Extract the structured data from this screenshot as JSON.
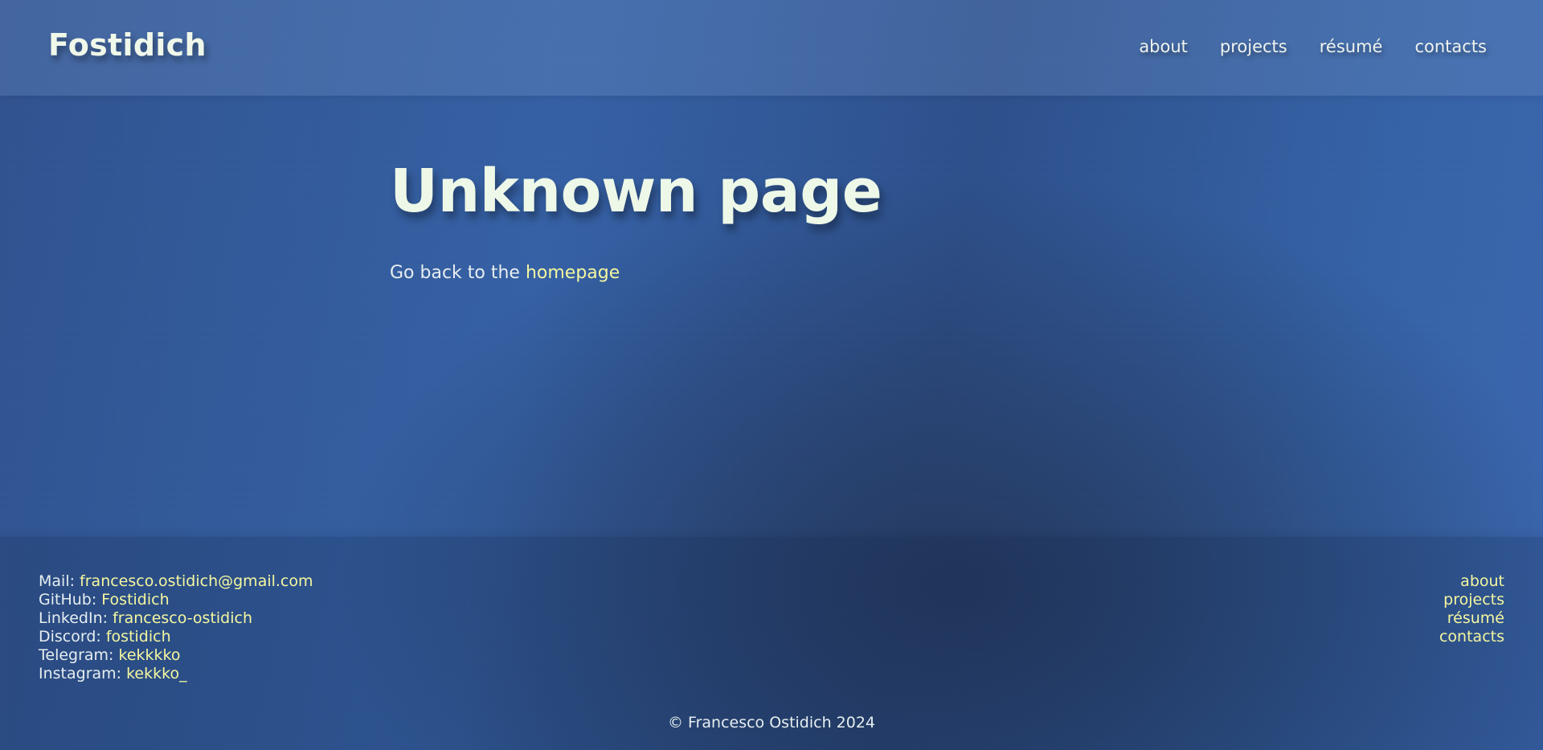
{
  "header": {
    "logo": "Fostidich",
    "nav": [
      "about",
      "projects",
      "résumé",
      "contacts"
    ]
  },
  "main": {
    "title": "Unknown page",
    "back_prefix": "Go back to the ",
    "back_link": "homepage"
  },
  "footer": {
    "contacts": [
      {
        "label": "Mail: ",
        "value": "francesco.ostidich@gmail.com"
      },
      {
        "label": "GitHub: ",
        "value": "Fostidich"
      },
      {
        "label": "LinkedIn: ",
        "value": "francesco-ostidich"
      },
      {
        "label": "Discord: ",
        "value": "fostidich"
      },
      {
        "label": "Telegram: ",
        "value": "kekkkko"
      },
      {
        "label": "Instagram: ",
        "value": "kekkko_"
      }
    ],
    "nav": [
      "about",
      "projects",
      "résumé",
      "contacts"
    ],
    "copyright": "© Francesco Ostidich 2024"
  },
  "colors": {
    "link": "#f4f7a0",
    "text": "#e8f0e8",
    "background": "#3460a6"
  }
}
